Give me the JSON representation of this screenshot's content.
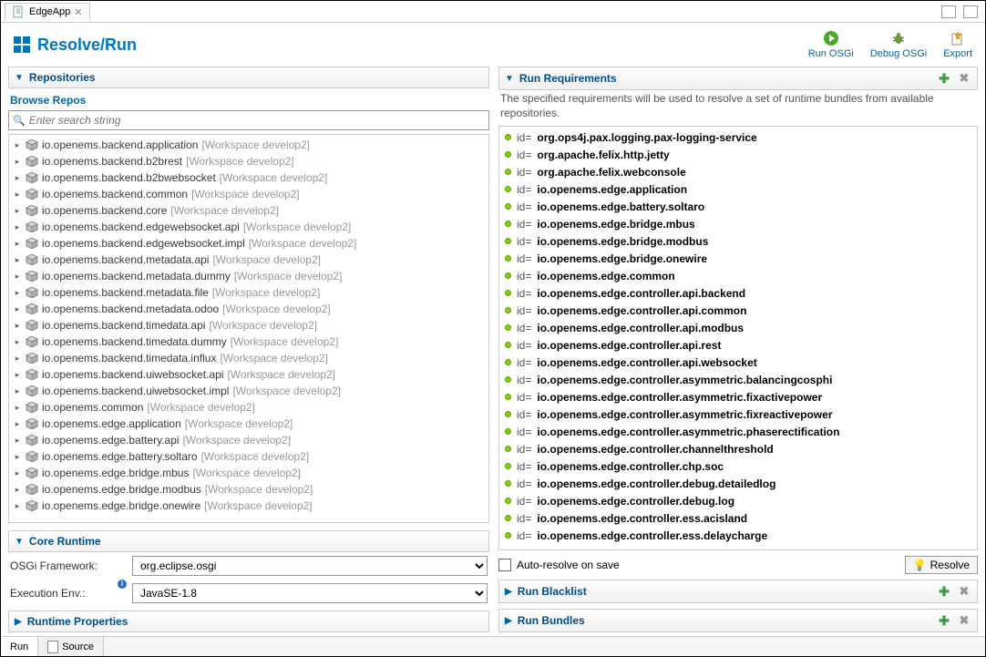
{
  "tab": {
    "title": "EdgeApp"
  },
  "header": {
    "title": "Resolve/Run",
    "actions": {
      "run": "Run OSGi",
      "debug": "Debug OSGi",
      "export": "Export"
    }
  },
  "left": {
    "repos_section": "Repositories",
    "browse_label": "Browse Repos",
    "search_placeholder": "Enter search string",
    "ws_suffix": "[Workspace develop2]",
    "bundles": [
      "io.openems.backend.application",
      "io.openems.backend.b2brest",
      "io.openems.backend.b2bwebsocket",
      "io.openems.backend.common",
      "io.openems.backend.core",
      "io.openems.backend.edgewebsocket.api",
      "io.openems.backend.edgewebsocket.impl",
      "io.openems.backend.metadata.api",
      "io.openems.backend.metadata.dummy",
      "io.openems.backend.metadata.file",
      "io.openems.backend.metadata.odoo",
      "io.openems.backend.timedata.api",
      "io.openems.backend.timedata.dummy",
      "io.openems.backend.timedata.influx",
      "io.openems.backend.uiwebsocket.api",
      "io.openems.backend.uiwebsocket.impl",
      "io.openems.common",
      "io.openems.edge.application",
      "io.openems.edge.battery.api",
      "io.openems.edge.battery.soltaro",
      "io.openems.edge.bridge.mbus",
      "io.openems.edge.bridge.modbus",
      "io.openems.edge.bridge.onewire"
    ],
    "core_runtime_section": "Core Runtime",
    "osgi_label": "OSGi Framework:",
    "osgi_value": "org.eclipse.osgi",
    "exec_label": "Execution Env.:",
    "exec_value": "JavaSE-1.8",
    "runtime_props_section": "Runtime Properties"
  },
  "right": {
    "req_section": "Run Requirements",
    "hint": "The specified requirements will be used to resolve a set of runtime bundles from available repositories.",
    "id_prefix": "id=",
    "requirements": [
      "org.ops4j.pax.logging.pax-logging-service",
      "org.apache.felix.http.jetty",
      "org.apache.felix.webconsole",
      "io.openems.edge.application",
      "io.openems.edge.battery.soltaro",
      "io.openems.edge.bridge.mbus",
      "io.openems.edge.bridge.modbus",
      "io.openems.edge.bridge.onewire",
      "io.openems.edge.common",
      "io.openems.edge.controller.api.backend",
      "io.openems.edge.controller.api.common",
      "io.openems.edge.controller.api.modbus",
      "io.openems.edge.controller.api.rest",
      "io.openems.edge.controller.api.websocket",
      "io.openems.edge.controller.asymmetric.balancingcosphi",
      "io.openems.edge.controller.asymmetric.fixactivepower",
      "io.openems.edge.controller.asymmetric.fixreactivepower",
      "io.openems.edge.controller.asymmetric.phaserectification",
      "io.openems.edge.controller.channelthreshold",
      "io.openems.edge.controller.chp.soc",
      "io.openems.edge.controller.debug.detailedlog",
      "io.openems.edge.controller.debug.log",
      "io.openems.edge.controller.ess.acisland",
      "io.openems.edge.controller.ess.delaycharge"
    ],
    "autoresolve": "Auto-resolve on save",
    "resolve_btn": "Resolve",
    "blacklist_section": "Run Blacklist",
    "bundles_section": "Run Bundles"
  },
  "bottom_tabs": {
    "run": "Run",
    "source": "Source"
  }
}
